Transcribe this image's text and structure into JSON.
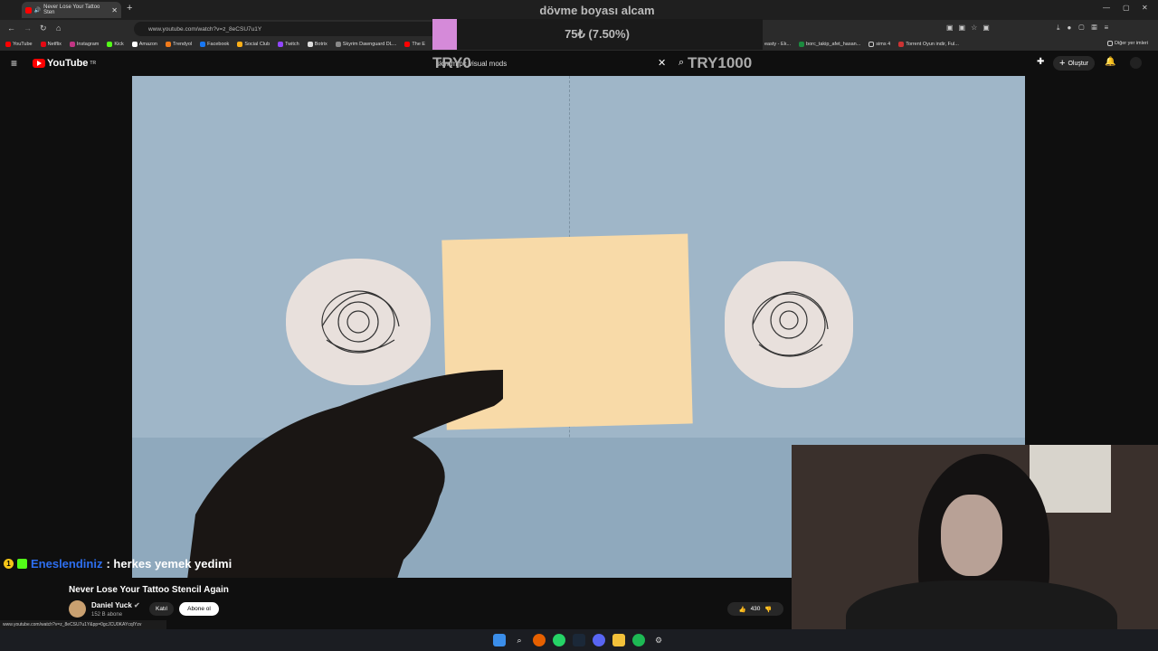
{
  "browser": {
    "tab_title": "Never Lose Your Tattoo Sten",
    "url": "www.youtube.com/watch?v=z_8eCSU7u1Y",
    "status_url": "www.youtube.com/watch?v=z_8eCSU7u1Y&pp=0gcJCU0KAYcqIYzv",
    "bookmarks": [
      "YouTube",
      "Netflix",
      "Instagram",
      "Kick",
      "Amazon",
      "Trendyol",
      "Facebook",
      "Social Club",
      "Twitch",
      "Botrix",
      "Skyrim Dawnguard DL...",
      "The E",
      "easty - Ek...",
      "borc_takip_afet_hasan...",
      "sims 4",
      "Torrent Oyun indir, Ful..."
    ],
    "other_bookmarks": "Diğer yer imleri"
  },
  "youtube": {
    "logo": "YouTube",
    "logo_sup": "TR",
    "search_value": "skyrim pc visual mods",
    "create_label": "Oluştur",
    "video_title": "Never Lose Your Tattoo Stencil Again",
    "channel": "Daniel Yuck",
    "subscribers": "152 B abone",
    "join_label": "Katıl",
    "subscribe_label": "Abone ol",
    "likes": "430"
  },
  "stream_overlay": {
    "goal_title": "dövme boyası alcam",
    "goal_progress_text": "75₺ (7.50%)",
    "goal_fraction": 0.075,
    "goal_min": "TRY0",
    "goal_max": "TRY1000",
    "chat_user": "Eneslendiniz",
    "chat_message": ": herkes yemek yedimi"
  },
  "colors": {
    "accent_red": "#ff0000",
    "goal_fill": "#d58ad9",
    "chat_user": "#2e6ff0"
  }
}
